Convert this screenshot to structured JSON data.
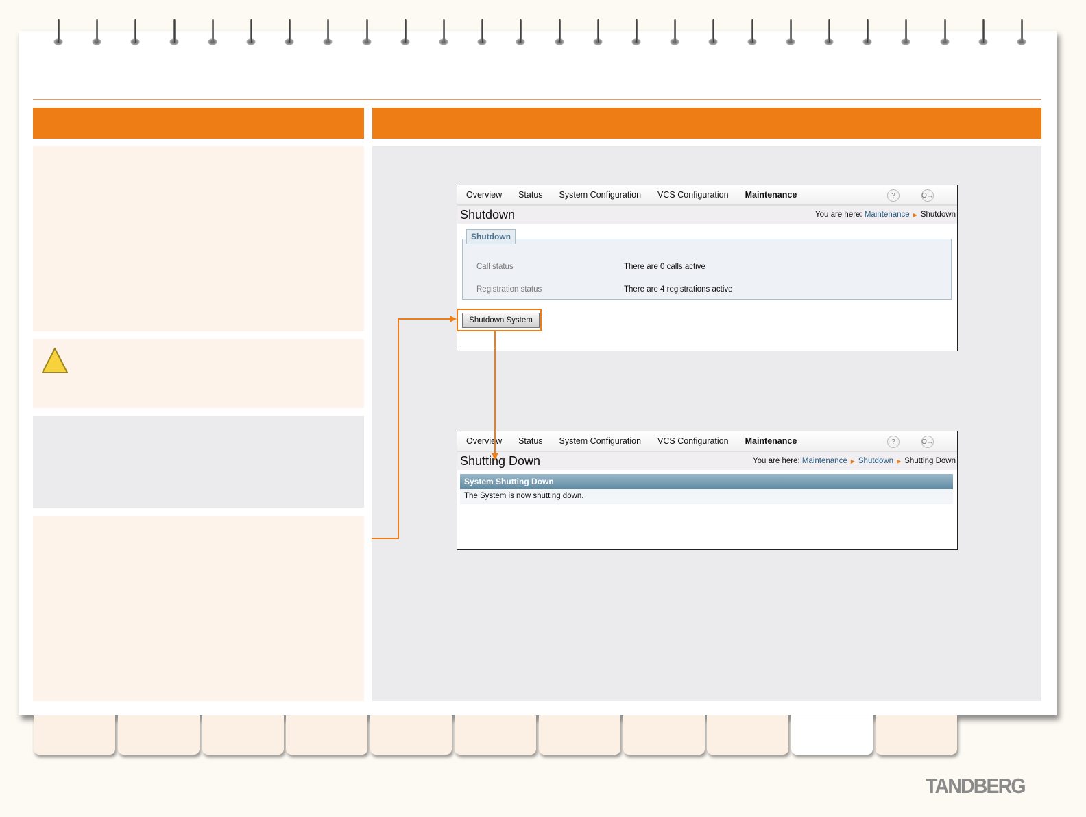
{
  "brand": {
    "logo": "TANDBERG",
    "accent": "#ed7d14"
  },
  "screen1": {
    "nav": [
      "Overview",
      "Status",
      "System Configuration",
      "VCS Configuration",
      "Maintenance"
    ],
    "active_nav": "Maintenance",
    "help_icon": "?",
    "logout_icon": "O→",
    "title": "Shutdown",
    "breadcrumb": {
      "prefix": "You are here:",
      "items": [
        "Maintenance"
      ],
      "current": "Shutdown"
    },
    "section_title": "Shutdown",
    "rows": [
      {
        "label": "Call status",
        "value": "There are 0 calls active"
      },
      {
        "label": "Registration status",
        "value": "There are 4 registrations active"
      }
    ],
    "button": "Shutdown System"
  },
  "screen2": {
    "nav": [
      "Overview",
      "Status",
      "System Configuration",
      "VCS Configuration",
      "Maintenance"
    ],
    "help_icon": "?",
    "logout_icon": "O→",
    "title": "Shutting Down",
    "breadcrumb": {
      "prefix": "You are here:",
      "items": [
        "Maintenance",
        "Shutdown"
      ],
      "current": "Shutting Down"
    },
    "section_title": "System Shutting Down",
    "message": "The System is now shutting down."
  }
}
